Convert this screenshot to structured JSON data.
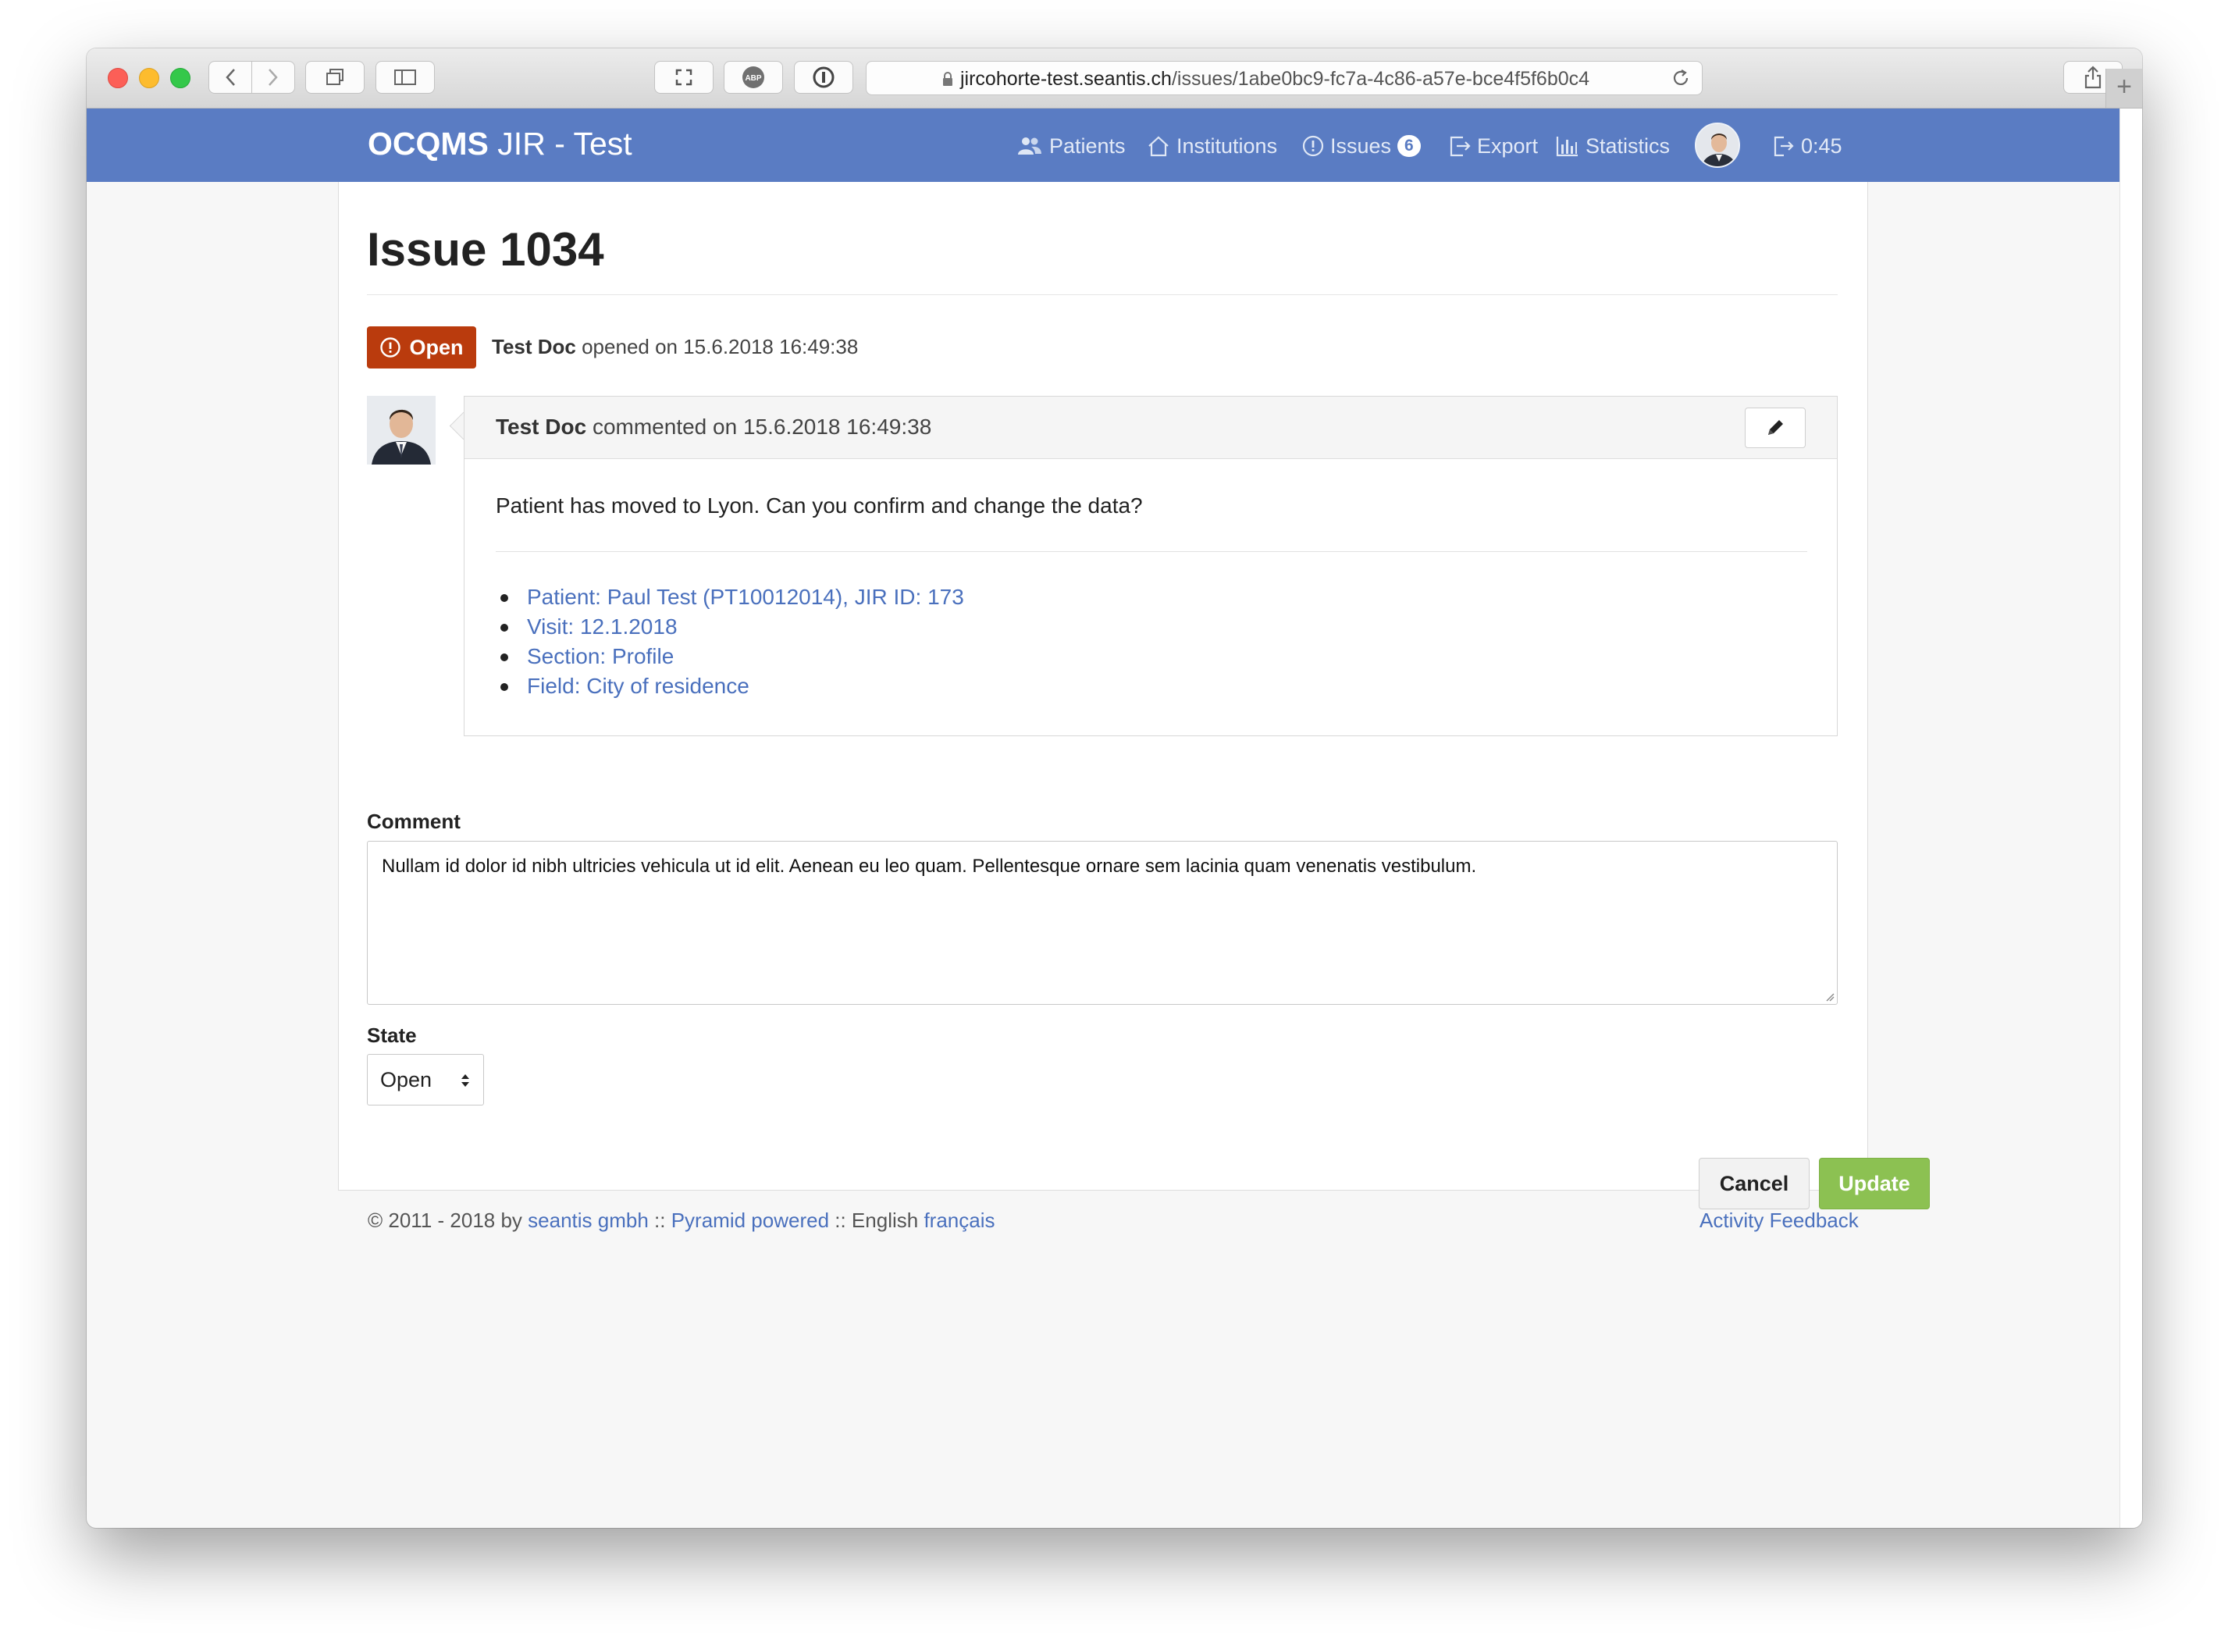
{
  "browser": {
    "url_host": "jircohorte-test.seantis.ch",
    "url_path": "/issues/1abe0bc9-fc7a-4c86-a57e-bce4f5f6b0c4",
    "newtab_label": "+"
  },
  "navbar": {
    "brand_bold": "OCQMS",
    "brand_light": " JIR - Test",
    "items": {
      "patients": "Patients",
      "institutions": "Institutions",
      "issues": "Issues",
      "issues_count": "6",
      "export": "Export",
      "statistics": "Statistics",
      "session_time": "0:45"
    }
  },
  "issue": {
    "title": "Issue 1034",
    "status": "Open",
    "opened_by": "Test Doc",
    "opened_text": " opened on 15.6.2018 16:49:38"
  },
  "comment": {
    "author": "Test Doc",
    "meta": " commented on 15.6.2018 16:49:38",
    "body": "Patient has moved to Lyon. Can you confirm and change the data?",
    "references": [
      "Patient: Paul Test (PT10012014), JIR ID: 173",
      "Visit: 12.1.2018",
      "Section: Profile",
      "Field: City of residence"
    ]
  },
  "form": {
    "comment_label": "Comment",
    "comment_value": "Nullam id dolor id nibh ultricies vehicula ut id elit. Aenean eu leo quam. Pellentesque ornare sem lacinia quam venenatis vestibulum.",
    "state_label": "State",
    "state_value": "Open",
    "cancel_label": "Cancel",
    "update_label": "Update"
  },
  "footer": {
    "copyright": "© 2011 - 2018 by ",
    "company_link": "seantis gmbh",
    "sep1": " :: ",
    "pyramid_link": "Pyramid powered",
    "sep2": " :: English ",
    "french_link": "français",
    "activity_link": "Activity",
    "feedback_link": "Feedback"
  },
  "colors": {
    "navbar": "#5a7cc3",
    "status_open": "#ba3b0d",
    "link": "#4a70bd",
    "update_button": "#8cc152"
  },
  "icons": [
    "back-icon",
    "forward-icon",
    "tabs-icon",
    "sidebar-icon",
    "fullscreen-icon",
    "adblock-icon",
    "password-icon",
    "lock-icon",
    "reload-icon",
    "share-icon",
    "users-icon",
    "home-icon",
    "alert-circle-icon",
    "export-icon",
    "bar-chart-icon",
    "logout-icon",
    "pencil-icon",
    "select-arrows-icon"
  ]
}
